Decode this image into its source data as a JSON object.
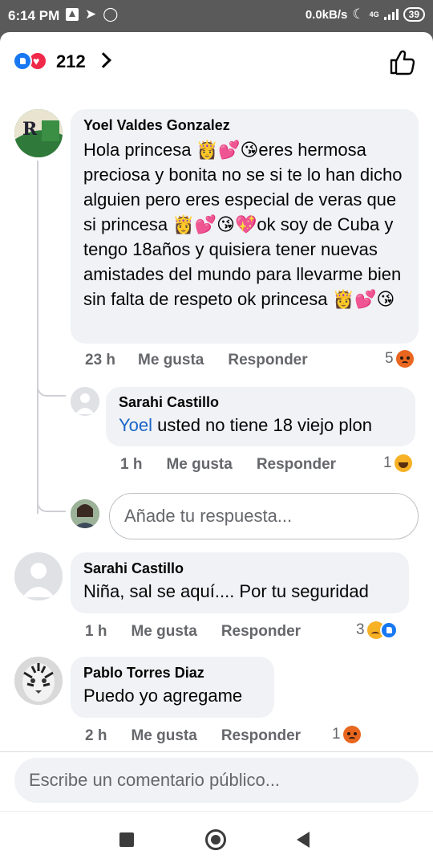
{
  "status_bar": {
    "time": "6:14 PM",
    "speed": "0.0kB/s",
    "network": "4G",
    "battery": "39"
  },
  "header": {
    "reaction_count": "212",
    "reaction_icons": [
      "like-icon",
      "love-icon"
    ]
  },
  "comments": [
    {
      "name": "Yoel Valdes Gonzalez",
      "text": "Hola princesa 👸💕😘eres hermosa preciosa y bonita no se si te lo han dicho alguien pero eres especial de veras que si princesa 👸💕😘💖ok soy de Cuba y tengo 18años y quisiera tener nuevas amistades del mundo para llevarme bien sin falta de respeto ok princesa 👸💕😘",
      "time": "23 h",
      "like": "Me gusta",
      "reply": "Responder",
      "reaction_count": "5",
      "reactions": [
        "angry"
      ]
    },
    {
      "name": "Sarahi Castillo",
      "mention": "Yoel",
      "text": " usted no tiene 18 viejo plon",
      "time": "1 h",
      "like": "Me gusta",
      "reply": "Responder",
      "reaction_count": "1",
      "reactions": [
        "haha"
      ]
    },
    {
      "name": "Sarahi Castillo",
      "text": "Niña, sal se aquí.... Por tu seguridad",
      "time": "1 h",
      "like": "Me gusta",
      "reply": "Responder",
      "reaction_count": "3",
      "reactions": [
        "sad",
        "like"
      ]
    },
    {
      "name": "Pablo Torres Diaz",
      "text": "Puedo yo agregame",
      "time": "2 h",
      "like": "Me gusta",
      "reply": "Responder",
      "reaction_count": "1",
      "reactions": [
        "angry"
      ]
    }
  ],
  "reply_input": {
    "placeholder": "Añade tu respuesta..."
  },
  "comment_input": {
    "placeholder": "Escribe un comentario público..."
  },
  "colors": {
    "accent": "#1877f2",
    "bubble": "#f0f2f5",
    "mention": "#1b66c9",
    "meta": "#65676b"
  }
}
